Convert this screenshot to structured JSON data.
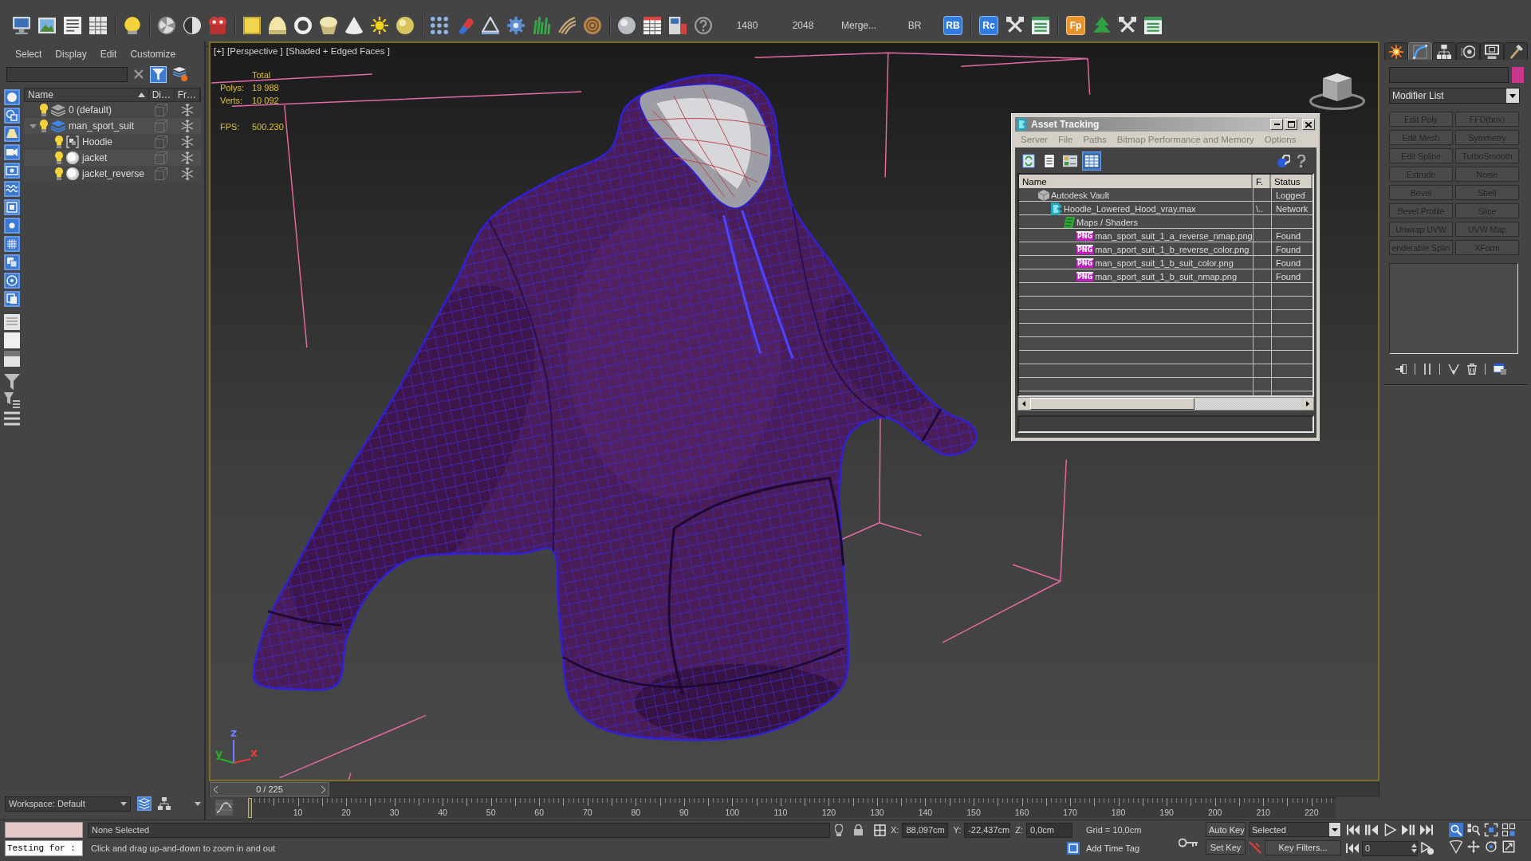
{
  "toolbar": {
    "labels": [
      "1480",
      "2048",
      "Merge...",
      "BR"
    ],
    "scripts": [
      {
        "label": "RB",
        "color": "#2f7be0"
      },
      {
        "label": "Rc",
        "color": "#2f7be0"
      },
      {
        "label": "Fp",
        "color": "#e8922a"
      }
    ]
  },
  "scene_explorer": {
    "menu": [
      "Select",
      "Display",
      "Edit",
      "Customize"
    ],
    "filter_active": true,
    "columns": [
      "Name",
      "Di…",
      "Fr…"
    ],
    "tree": [
      {
        "name": "0 (default)",
        "kind": "layer",
        "current": false,
        "visible": true
      },
      {
        "name": "man_sport_suit",
        "kind": "layer",
        "current": true,
        "visible": true,
        "expanded": true,
        "children": [
          {
            "name": "Hoodie",
            "kind": "group",
            "visible": true
          },
          {
            "name": "jacket",
            "kind": "object",
            "visible": true
          },
          {
            "name": "jacket_reverse",
            "kind": "object",
            "visible": true
          }
        ]
      }
    ],
    "workspace": "Workspace: Default"
  },
  "viewport": {
    "labels": [
      "[+]",
      "[Perspective ]",
      "[Shaded + Edged Faces ]"
    ],
    "stats": {
      "title": "Total",
      "rows": [
        {
          "label": "Polys:",
          "value": "19 988"
        },
        {
          "label": "Verts:",
          "value": "10 092"
        }
      ],
      "fps": {
        "label": "FPS:",
        "value": "500.230"
      }
    },
    "axes": [
      {
        "label": "z",
        "color": "#6c7cff"
      },
      {
        "label": "y",
        "color": "#2cb02c"
      },
      {
        "label": "x",
        "color": "#ee3a3a"
      }
    ]
  },
  "asset_tracking": {
    "title": "Asset Tracking",
    "menu": [
      "Server",
      "File",
      "Paths",
      "Bitmap Performance and Memory",
      "Options"
    ],
    "view_buttons": [
      {
        "selected": false
      },
      {
        "selected": false
      },
      {
        "selected": false
      },
      {
        "selected": true
      }
    ],
    "columns": [
      "Name",
      "F.",
      "Status"
    ],
    "tree": [
      {
        "name": "Autodesk Vault",
        "kind": "provider",
        "status": "Logged",
        "children": [
          {
            "name": "Hoodie_Lowered_Hood_vray.max",
            "kind": "scene",
            "path": "\\..",
            "status": "Network",
            "children": [
              {
                "name": "Maps / Shaders",
                "kind": "folder",
                "children": [
                  {
                    "name": "man_sport_suit_1_a_reverse_nmap.png",
                    "kind": "bitmap",
                    "badge": "PNG",
                    "status": "Found"
                  },
                  {
                    "name": "man_sport_suit_1_b_reverse_color.png",
                    "kind": "bitmap",
                    "badge": "PNG",
                    "status": "Found"
                  },
                  {
                    "name": "man_sport_suit_1_b_suit_color.png",
                    "kind": "bitmap",
                    "badge": "PNG",
                    "status": "Found"
                  },
                  {
                    "name": "man_sport_suit_1_b_suit_nmap.png",
                    "kind": "bitmap",
                    "badge": "PNG",
                    "status": "Found"
                  }
                ]
              }
            ]
          }
        ]
      }
    ]
  },
  "command_panel": {
    "tabs": [
      {
        "selected": false
      },
      {
        "selected": true
      },
      {
        "selected": false
      },
      {
        "selected": false
      },
      {
        "selected": false
      },
      {
        "selected": false
      }
    ],
    "swatch": {
      "color": "#c8378c"
    },
    "modifier_list": "Modifier List",
    "modifiers": [
      {
        "label": "Edit Poly",
        "disabled": true
      },
      {
        "label": "FFD(box)",
        "disabled": true
      },
      {
        "label": "Edit Mesh",
        "disabled": true
      },
      {
        "label": "Symmetry",
        "disabled": true
      },
      {
        "label": "Edit Spline",
        "disabled": true
      },
      {
        "label": "TurboSmooth",
        "disabled": true
      },
      {
        "label": "Extrude",
        "disabled": true
      },
      {
        "label": "Noise",
        "disabled": true
      },
      {
        "label": "Bevel",
        "disabled": true
      },
      {
        "label": "Shell",
        "disabled": true
      },
      {
        "label": "Bevel Profile",
        "disabled": true
      },
      {
        "label": "Slice",
        "disabled": true
      },
      {
        "label": "Unwrap UVW",
        "disabled": true
      },
      {
        "label": "UVW Map",
        "disabled": true
      },
      {
        "label": "enderable Splin",
        "disabled": true
      },
      {
        "label": "XForm",
        "disabled": true
      }
    ]
  },
  "timeline": {
    "slider": {
      "label": "0 / 225",
      "level": 0
    },
    "ticks": [
      "10",
      "20",
      "30",
      "40",
      "50",
      "60",
      "70",
      "80",
      "90",
      "100",
      "110",
      "120",
      "130",
      "140",
      "150",
      "160",
      "170",
      "180",
      "190",
      "200",
      "210",
      "220"
    ]
  },
  "status_bar": {
    "listener_input": "Testing for :",
    "selection": "None Selected",
    "prompt": "Click and drag up-and-down to zoom in and out",
    "coords": [
      {
        "label": "X:",
        "value": "88,097cm"
      },
      {
        "label": "Y:",
        "value": "-22,437cm"
      },
      {
        "label": "Z:",
        "value": "0,0cm"
      }
    ],
    "grid": "Grid = 10,0cm",
    "time_tag": "Add Time Tag",
    "auto_key": "Auto Key",
    "key_mode": "Selected",
    "set_key": "Set Key",
    "key_filters": "Key Filters...",
    "frame": "0",
    "viewport_tools": [
      {
        "selected": true
      },
      {
        "selected": false
      },
      {
        "selected": false
      },
      {
        "selected": false
      },
      {
        "selected": false
      },
      {
        "selected": false
      },
      {
        "selected": false
      },
      {
        "selected": false
      }
    ]
  }
}
